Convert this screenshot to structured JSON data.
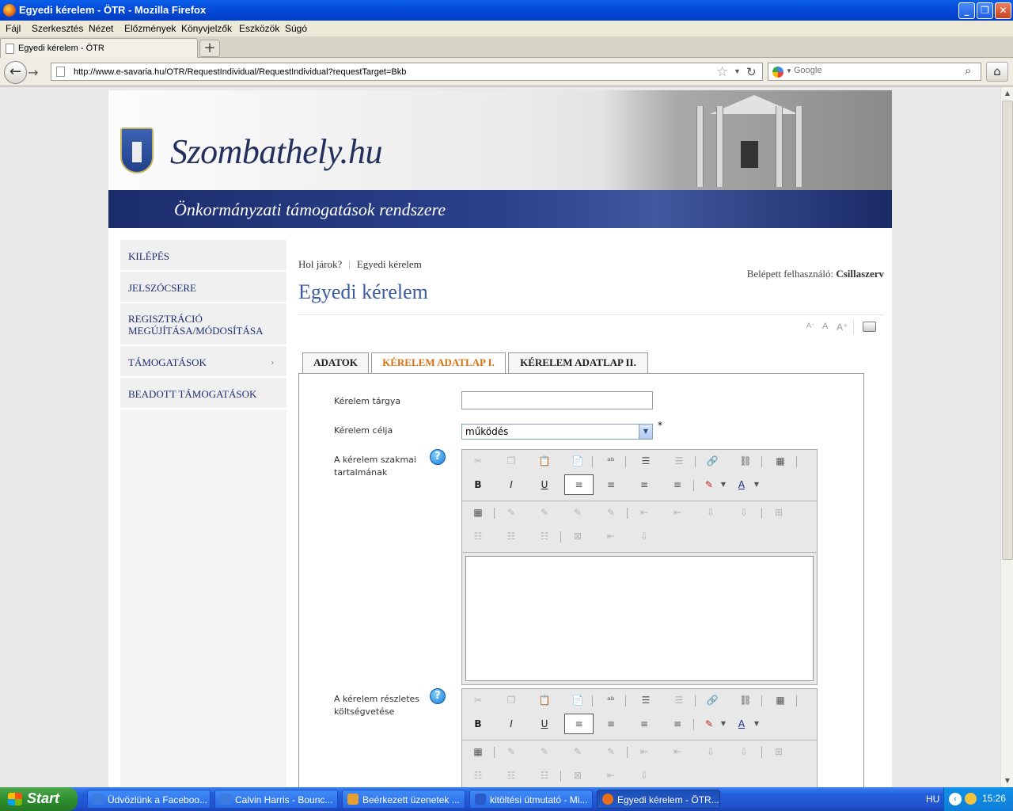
{
  "window": {
    "title": "Egyedi kérelem - ÖTR - Mozilla Firefox"
  },
  "menu": [
    "Fájl",
    "Szerkesztés",
    "Nézet",
    "Előzmények",
    "Könyvjelzők",
    "Eszközök",
    "Súgó"
  ],
  "tab": {
    "label": "Egyedi kérelem - ÖTR"
  },
  "url": "http://www.e-savaria.hu/OTR/RequestIndividual/RequestIndividual?requestTarget=Bkb",
  "search": {
    "placeholder": "Google"
  },
  "site": {
    "title": "Szombathely.hu",
    "banner": "Önkormányzati támogatások rendszere"
  },
  "sidebar": [
    {
      "label": "KILÉPÉS"
    },
    {
      "label": "JELSZÓCSERE"
    },
    {
      "label": "REGISZTRÁCIÓ MEGÚJÍTÁSA/MÓDOSÍTÁSA"
    },
    {
      "label": "TÁMOGATÁSOK"
    },
    {
      "label": "BEADOTT TÁMOGATÁSOK"
    }
  ],
  "breadcrumb": {
    "where": "Hol járok?",
    "current": "Egyedi kérelem"
  },
  "user": {
    "prefix": "Belépett felhasználó:",
    "name": "Csillaszerv"
  },
  "page_title": "Egyedi kérelem",
  "tabs": [
    "ADATOK",
    "KÉRELEM ADATLAP I.",
    "KÉRELEM ADATLAP II."
  ],
  "form": {
    "subject_label": "Kérelem tárgya",
    "subject_value": "",
    "purpose_label": "Kérelem célja",
    "purpose_value": "működés",
    "required_mark": "*",
    "content_label": "A kérelem szakmai tartalmának",
    "budget_label": "A kérelem részletes költségvetése",
    "help_glyph": "?"
  },
  "taskbar": {
    "start": "Start",
    "items": [
      {
        "label": "Üdvözlünk a Faceboo...",
        "icon_color": "#3a7be0"
      },
      {
        "label": "Calvin Harris - Bounc...",
        "icon_color": "#3a7be0"
      },
      {
        "label": "Beérkezett üzenetek ...",
        "icon_color": "#e8a030"
      },
      {
        "label": "kitöltési útmutató - Mi...",
        "icon_color": "#2a5bc8"
      },
      {
        "label": "Egyedi kérelem - ÖTR...",
        "icon_color": "#e8701a"
      }
    ],
    "lang": "HU",
    "clock": "15:26"
  }
}
